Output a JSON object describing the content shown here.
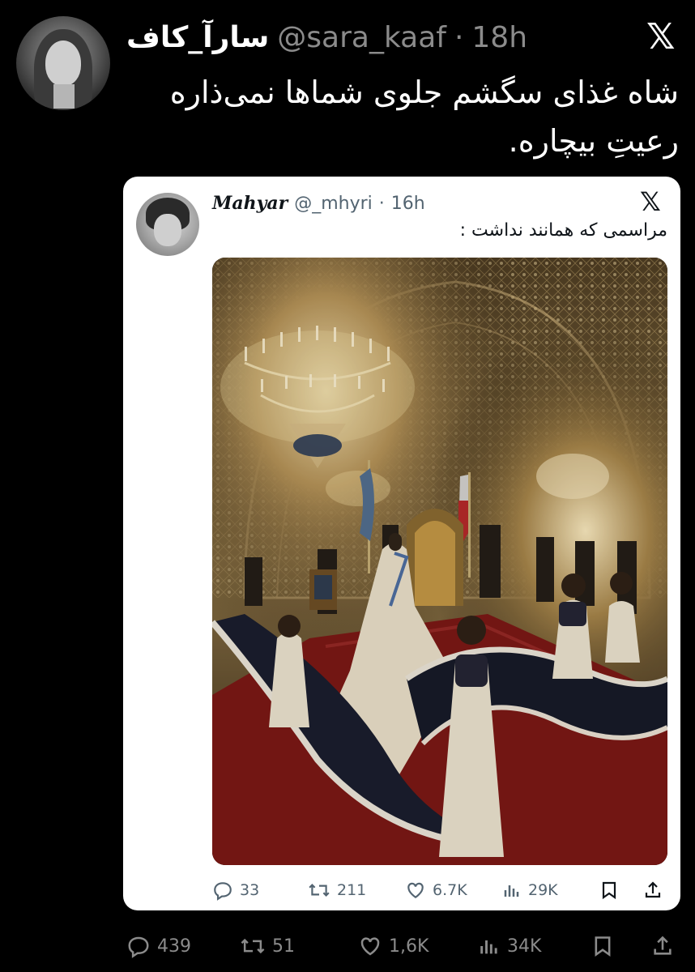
{
  "outer_tweet": {
    "display_name": "سارآ_کاف",
    "handle": "@sara_kaaf",
    "separator": "·",
    "time": "18h",
    "text": "شاه غذای سگشم جلوی شماها نمی‌ذاره رعیتِ بیچاره.",
    "logo": "x-logo"
  },
  "quoted_tweet": {
    "display_name": "Mahyar",
    "handle": "@_mhyri",
    "separator": "·",
    "time": "16h",
    "text": "مراسمی که همانند نداشت :",
    "logo": "x-logo",
    "stats": {
      "replies": "33",
      "retweets": "211",
      "likes": "6.7K",
      "views": "29K"
    }
  },
  "outer_stats": {
    "replies": "439",
    "retweets": "51",
    "likes": "1,6K",
    "views": "34K"
  },
  "icons": [
    "reply-icon",
    "retweet-icon",
    "like-icon",
    "views-icon",
    "bookmark-icon",
    "share-icon"
  ],
  "colors": {
    "background": "#000000",
    "card": "#ffffff",
    "muted_dark": "#8b8b8b",
    "muted_light": "#536471"
  }
}
